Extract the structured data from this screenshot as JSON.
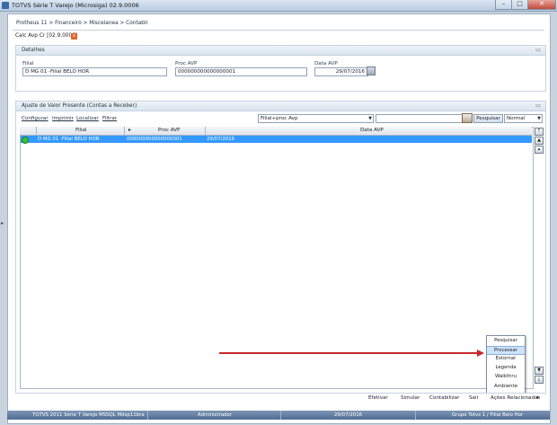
{
  "window": {
    "title": "TOTVS Série T Varejo (Microsiga) 02.9.0006",
    "min": "–",
    "max": "□",
    "close": "✕"
  },
  "breadcrumb": "Protheus 11 > Financeiro > Miscelanea > Contabil",
  "tab": {
    "label": "Calc Avp Cr [02.9.0006]",
    "close": "x"
  },
  "detalhes": {
    "title": "Detalhes",
    "filial_label": "Filial",
    "filial_value": "D MG 01 -Filial BELO HOR",
    "proc_label": "Proc AVP",
    "proc_value": "000000000000000001",
    "data_label": "Data AVP",
    "data_value": "29/07/2016"
  },
  "ajuste": {
    "title": "Ajuste de Valor Presente (Contas a Receber)",
    "toolbar": {
      "configurar": "Configurar",
      "imprimir": "Imprimir",
      "localizar": "Localizar",
      "filtrar": "Filtrar"
    },
    "order_select": "Filial+proc Avp",
    "search_value": "",
    "pesquisar": "Pesquisar",
    "mode_select": "Normal",
    "columns": [
      "Filial",
      "Proc AVP",
      "Data AVP"
    ],
    "rows": [
      {
        "filial": "D MG 01 -Filial BELO HOR",
        "proc": "000000000000000001",
        "data": "29/07/2016"
      }
    ]
  },
  "popup_menu": [
    "Pesquisar",
    "Processar",
    "Estornar",
    "Legenda",
    "Walkthru",
    "Ambiente"
  ],
  "popup_selected": "Processar",
  "footer": {
    "efetivar": "Efetivar",
    "simular": "Simular",
    "contabilizar": "Contabilizar",
    "sair": "Sair",
    "acoes": "Ações Relacionadas"
  },
  "statusbar": [
    "TOTVS 2011 Série T Varejo MSSQL Mdsp11bra",
    "Administrador",
    "29/07/2016",
    "Grupo Totvs 1 / Filial Belo Hor"
  ],
  "colors": {
    "selection": "#3399ff",
    "arrow": "#c8282a",
    "statusbar": "#5a7aa3"
  }
}
